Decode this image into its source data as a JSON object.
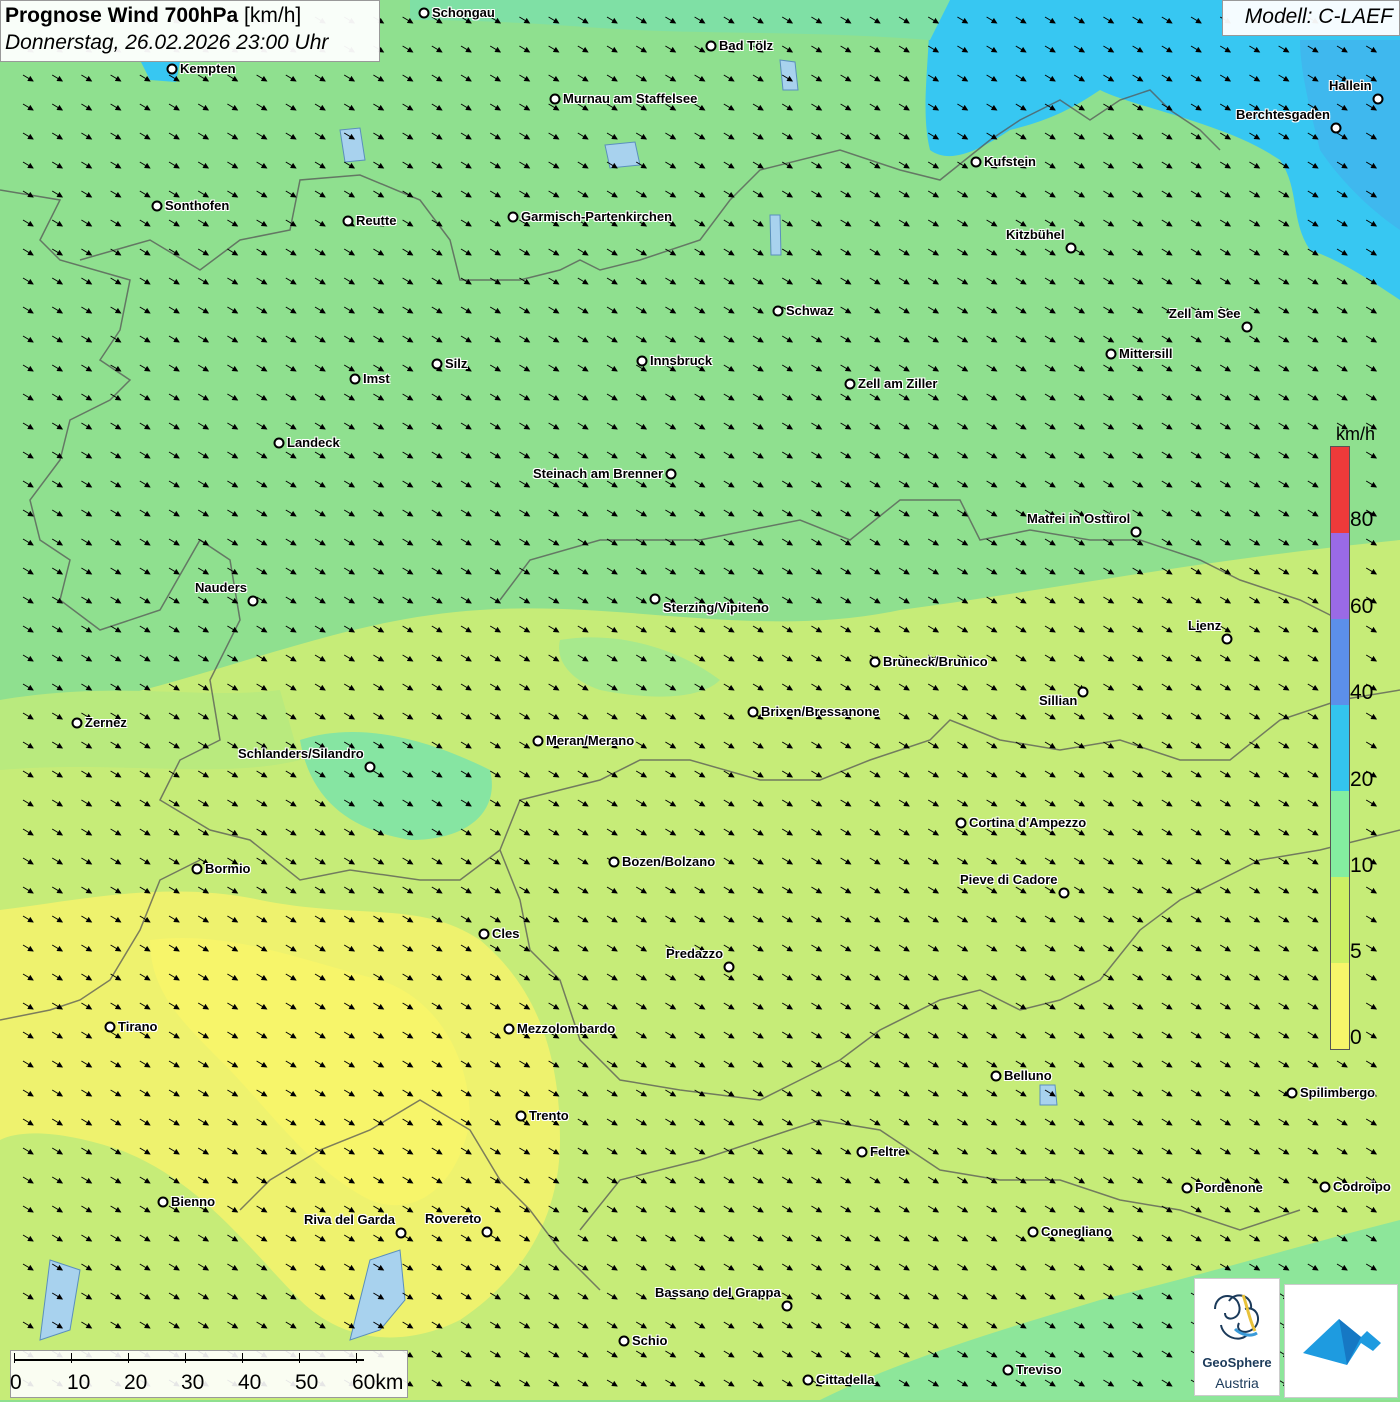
{
  "header": {
    "title_bold": "Prognose Wind 700hPa",
    "title_unit": "[km/h]",
    "subtitle": "Donnerstag, 26.02.2026 23:00 Uhr"
  },
  "model": {
    "label": "Modell: C-LAEF"
  },
  "legend": {
    "unit": "km/h",
    "segments": [
      {
        "color": "#f7f56a"
      },
      {
        "color": "#ccf064"
      },
      {
        "color": "#84eea0"
      },
      {
        "color": "#33c4ee"
      },
      {
        "color": "#5c8fea"
      },
      {
        "color": "#9a6ae6"
      },
      {
        "color": "#ee3a3a"
      }
    ],
    "ticks": [
      "0",
      "5",
      "10",
      "20",
      "40",
      "60",
      "80"
    ]
  },
  "scale_bar": {
    "labels": [
      "0",
      "10",
      "20",
      "30",
      "40",
      "50",
      "60km"
    ]
  },
  "wind_field": {
    "direction_of_flow": "northwest to southeast",
    "arrow_glyph": "arrow"
  },
  "cities": [
    {
      "name": "Schongau"
    },
    {
      "name": "Bad Tölz"
    },
    {
      "name": "Kempten"
    },
    {
      "name": "Murnau am Staffelsee"
    },
    {
      "name": "Hallein"
    },
    {
      "name": "Berchtesgaden"
    },
    {
      "name": "Kufstein"
    },
    {
      "name": "Sonthofen"
    },
    {
      "name": "Reutte"
    },
    {
      "name": "Garmisch-Partenkirchen"
    },
    {
      "name": "Kitzbühel"
    },
    {
      "name": "Schwaz"
    },
    {
      "name": "Zell am See"
    },
    {
      "name": "Mittersill"
    },
    {
      "name": "Innsbruck"
    },
    {
      "name": "Silz"
    },
    {
      "name": "Imst"
    },
    {
      "name": "Zell am Ziller"
    },
    {
      "name": "Landeck"
    },
    {
      "name": "Steinach am Brenner"
    },
    {
      "name": "Matrei in Osttirol"
    },
    {
      "name": "Nauders"
    },
    {
      "name": "Sterzing/Vipiteno"
    },
    {
      "name": "Lienz"
    },
    {
      "name": "Bruneck/Brunico"
    },
    {
      "name": "Sillian"
    },
    {
      "name": "Brixen/Bressanone"
    },
    {
      "name": "Zernez"
    },
    {
      "name": "Meran/Merano"
    },
    {
      "name": "Schlanders/Silandro"
    },
    {
      "name": "Cortina d'Ampezzo"
    },
    {
      "name": "Bozen/Bolzano"
    },
    {
      "name": "Bormio"
    },
    {
      "name": "Pieve di Cadore"
    },
    {
      "name": "Cles"
    },
    {
      "name": "Predazzo"
    },
    {
      "name": "Tirano"
    },
    {
      "name": "Mezzolombardo"
    },
    {
      "name": "Belluno"
    },
    {
      "name": "Spilimbergo"
    },
    {
      "name": "Trento"
    },
    {
      "name": "Feltre"
    },
    {
      "name": "Pordenone"
    },
    {
      "name": "Codroipo"
    },
    {
      "name": "Bienno"
    },
    {
      "name": "Riva del Garda"
    },
    {
      "name": "Rovereto"
    },
    {
      "name": "Conegliano"
    },
    {
      "name": "Bassano del Grappa"
    },
    {
      "name": "Schio"
    },
    {
      "name": "Treviso"
    },
    {
      "name": "Cittadella"
    }
  ],
  "logos": {
    "geosphere_line1": "GeoSphere",
    "geosphere_line2": "Austria"
  }
}
